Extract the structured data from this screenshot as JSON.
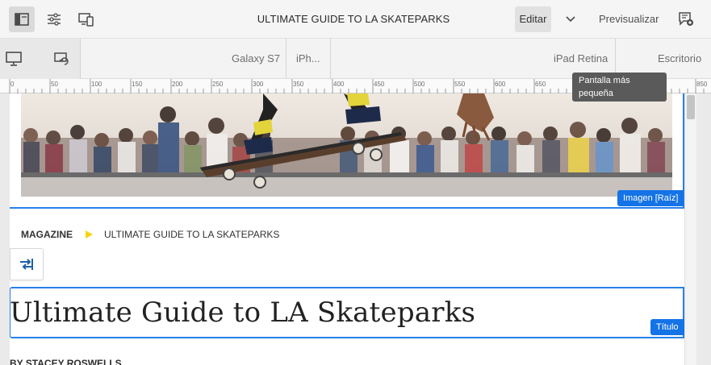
{
  "toolbar": {
    "doc_title": "ULTIMATE GUIDE TO LA SKATEPARKS",
    "edit_label": "Editar",
    "preview_label": "Previsualizar",
    "icons": [
      "side-panel-icon",
      "page-properties-icon",
      "emulator-icon",
      "chevron-down-icon",
      "annotations-icon"
    ]
  },
  "emulator": {
    "icons": [
      "desktop-icon",
      "rotate-device-icon"
    ],
    "devices": [
      "Galaxy S7",
      "iPh...",
      "iPad Retina",
      "Escritorio"
    ]
  },
  "ruler": {
    "marks": [
      "0",
      "50",
      "100",
      "150",
      "200",
      "250",
      "300",
      "350",
      "400",
      "450",
      "500",
      "550",
      "600",
      "650",
      "850"
    ]
  },
  "tooltip": {
    "text": "Pantalla más pequeña"
  },
  "page": {
    "hero_badge": "Imagen [Raíz]",
    "breadcrumb": {
      "parent": "MAGAZINE",
      "current": "ULTIMATE GUIDE TO LA SKATEPARKS"
    },
    "title": "Ultimate Guide to LA Skateparks",
    "title_badge": "Título",
    "byline": "BY STACEY ROSWELLS"
  },
  "colors": {
    "accent": "#1473e6",
    "selection": "#2680eb",
    "breadcrumb_arrow": "#f6d410"
  }
}
